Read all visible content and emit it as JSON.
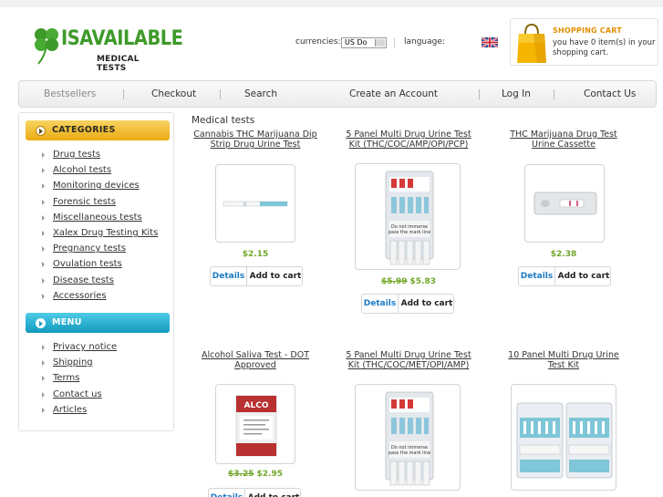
{
  "header": {
    "brand": "ISAVAILABLE",
    "brand_sub": "MEDICAL TESTS",
    "currencies_label": "currencies:",
    "currency_value": "US Do",
    "language_label": "language:",
    "language_flag_icon": "uk-flag-icon",
    "cart": {
      "title": "SHOPPING CART",
      "message": "you have 0 item(s) in your shopping cart."
    }
  },
  "nav": {
    "items": [
      "Bestsellers",
      "Checkout",
      "Search",
      "Create an Account",
      "Log In",
      "Contact Us"
    ]
  },
  "sidebar": {
    "categories_title": "CATEGORIES",
    "categories": [
      "Drug tests",
      "Alcohol tests",
      "Monitoring devices",
      "Forensic tests",
      "Miscellaneous tests",
      "Xalex Drug Testing Kits",
      "Pregnancy tests",
      "Ovulation tests",
      "Disease tests",
      "Accessories"
    ],
    "menu_title": "MENU",
    "menu": [
      "Privacy notice",
      "Shipping",
      "Terms",
      "Contact us",
      "Articles"
    ]
  },
  "main": {
    "title": "Medical tests",
    "details_label": "Details",
    "add_label": "Add to cart",
    "products": [
      {
        "name": "Cannabis THC Marijuana Dip Strip Drug Urine Test",
        "old_price": "",
        "price": "$2.15",
        "image_icon": "dip-strip-icon"
      },
      {
        "name": "5 Panel Multi Drug Urine Test Kit (THC/COC/AMP/OPI/PCP)",
        "old_price": "$5.99",
        "price": "$5.83",
        "image_icon": "test-panel-icon"
      },
      {
        "name": "THC Marijuana Drug Test Urine Cassette",
        "old_price": "",
        "price": "$2.38",
        "image_icon": "cassette-icon"
      },
      {
        "name": "Alcohol Saliva Test - DOT Approved",
        "old_price": "$3.25",
        "price": "$2.95",
        "image_icon": "saliva-kit-icon"
      },
      {
        "name": "5 Panel Multi Drug Urine Test Kit (THC/COC/MET/OPI/AMP)",
        "old_price": "",
        "price": "",
        "image_icon": "test-panel-icon"
      },
      {
        "name": "10 Panel Multi Drug Urine Test Kit",
        "old_price": "",
        "price": "",
        "image_icon": "ten-panel-icon"
      }
    ]
  }
}
